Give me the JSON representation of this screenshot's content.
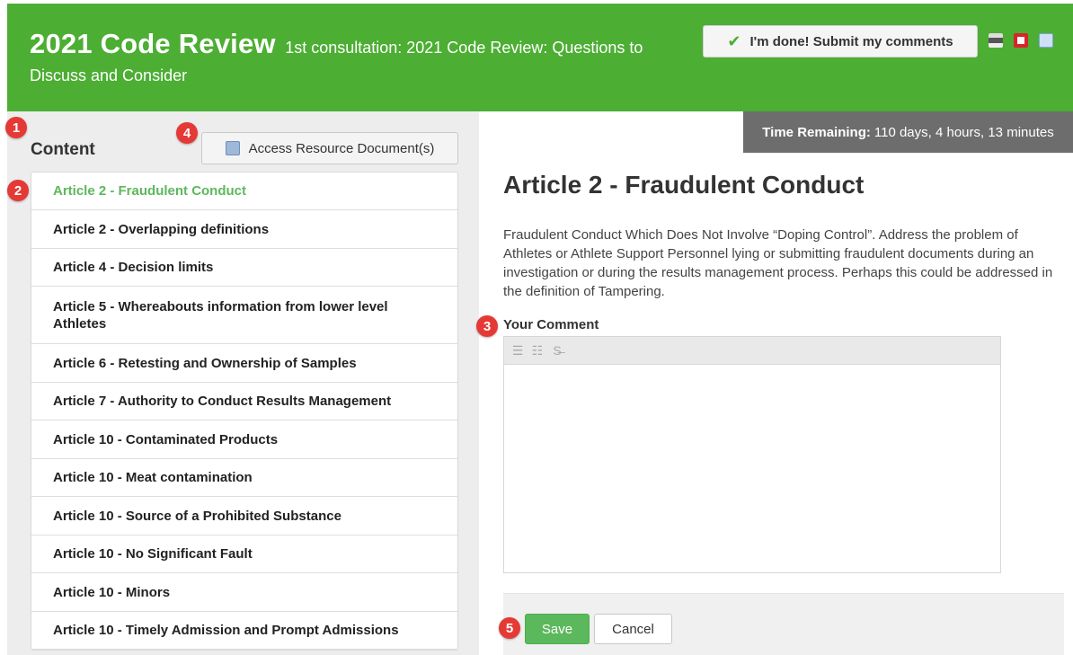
{
  "header": {
    "title": "2021 Code Review",
    "subtitle_line1": "1st consultation: 2021 Code Review: Questions to",
    "subtitle_line2": "Discuss and Consider",
    "submit_label": "I'm done! Submit my comments",
    "icons": [
      "check-icon",
      "print-icon",
      "pdf-icon",
      "mail-icon"
    ]
  },
  "sidebar": {
    "heading": "Content",
    "resource_button": "Access Resource Document(s)",
    "items": [
      {
        "label": "Article 2 - Fraudulent Conduct",
        "active": true
      },
      {
        "label": "Article 2 - Overlapping definitions"
      },
      {
        "label": "Article 4 - Decision limits"
      },
      {
        "label": "Article 5 - Whereabouts information from lower level Athletes"
      },
      {
        "label": "Article 6 - Retesting and Ownership of Samples"
      },
      {
        "label": "Article 7 - Authority to Conduct Results Management"
      },
      {
        "label": "Article 10 - Contaminated Products"
      },
      {
        "label": "Article 10 - Meat contamination"
      },
      {
        "label": "Article 10 - Source of a Prohibited Substance"
      },
      {
        "label": "Article 10 - No Significant Fault"
      },
      {
        "label": "Article 10 - Minors"
      },
      {
        "label": "Article 10 - Timely Admission and Prompt Admissions"
      }
    ]
  },
  "timer": {
    "label": "Time Remaining:",
    "value": "110 days, 4 hours, 13 minutes"
  },
  "main": {
    "article_title": "Article 2 - Fraudulent Conduct",
    "article_description": "Fraudulent Conduct Which Does Not Involve “Doping Control”. Address the problem of Athletes or Athlete Support Personnel lying or submitting fraudulent documents during an investigation or during the results management process. Perhaps this could be addressed in the definition of Tampering.",
    "comment_label": "Your Comment",
    "comment_value": "",
    "toolbar_icons": [
      "numbered-list-icon",
      "bullet-list-icon",
      "strikethrough-icon"
    ],
    "save_label": "Save",
    "cancel_label": "Cancel"
  },
  "markers": [
    "1",
    "2",
    "3",
    "4",
    "5"
  ],
  "colors": {
    "header_green": "#4cae33",
    "active_item": "#5cb85c",
    "save_button": "#5cb85c",
    "timer_bg": "#6d6d6d",
    "marker_red": "#e53935"
  }
}
